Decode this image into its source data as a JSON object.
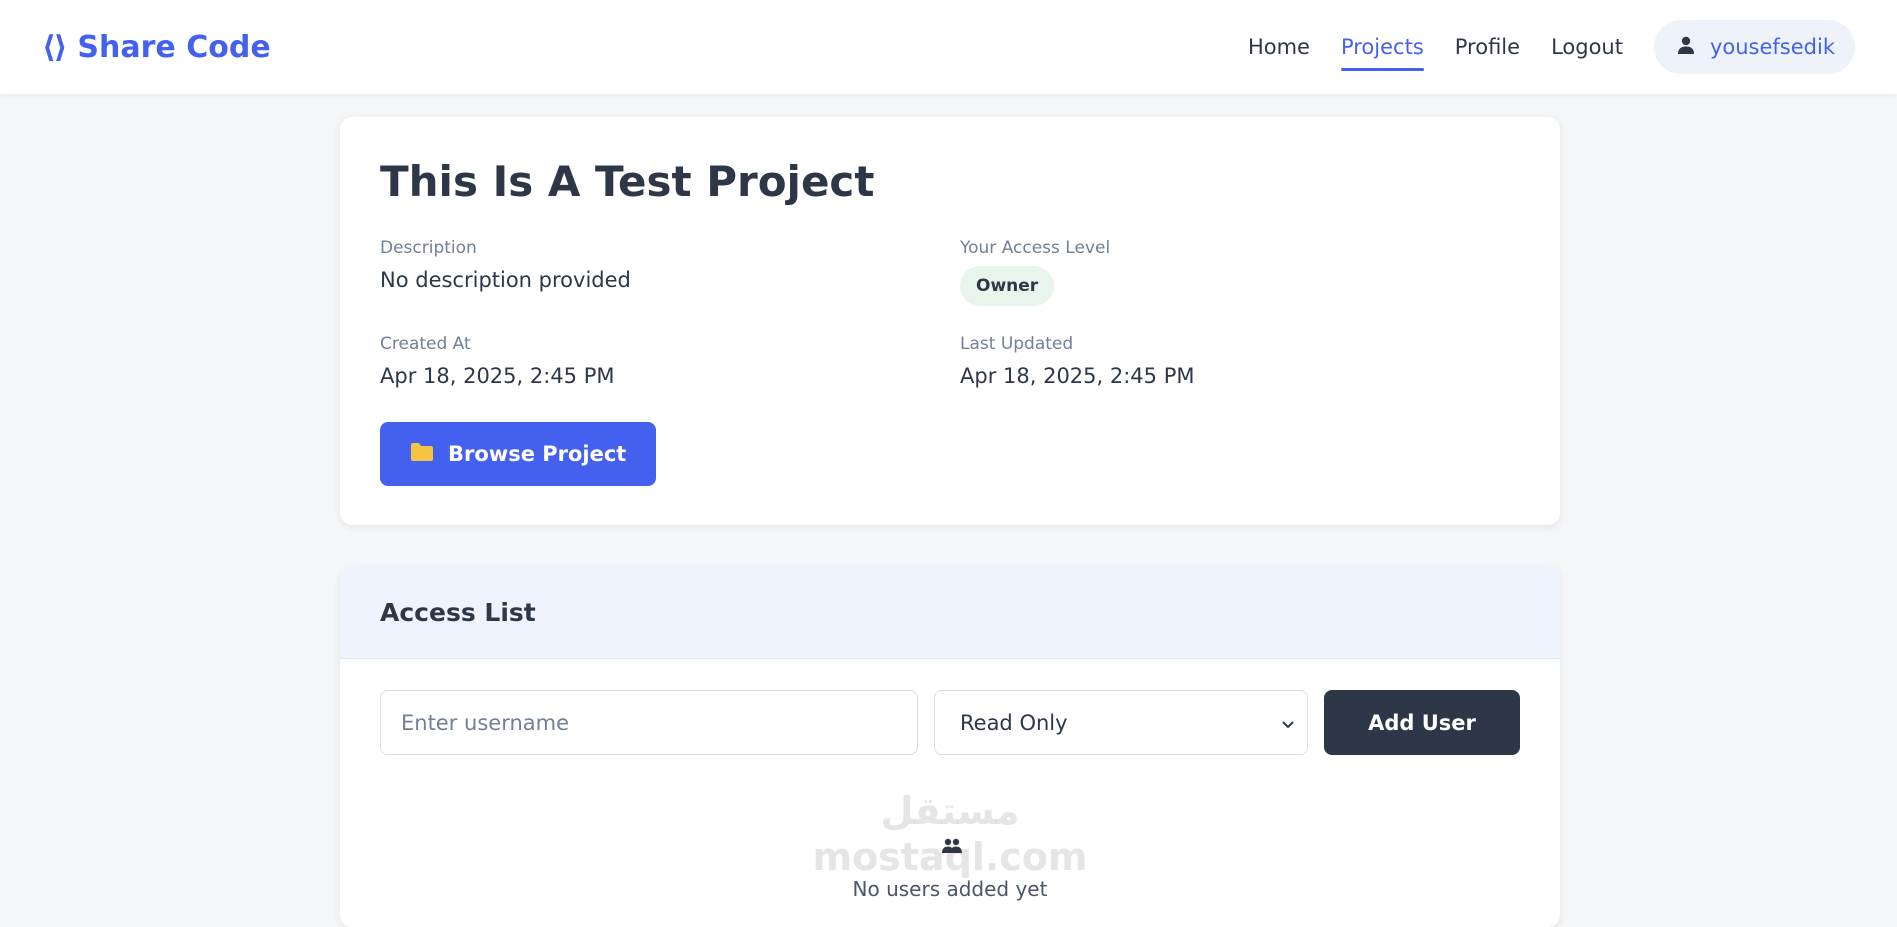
{
  "navbar": {
    "brand_text": "Share Code",
    "brand_icon": "code-icon",
    "links": [
      {
        "label": "Home"
      },
      {
        "label": "Projects"
      },
      {
        "label": "Profile"
      },
      {
        "label": "Logout"
      }
    ],
    "active_link": "Projects",
    "username": "yousefsedik",
    "user_icon": "user-icon"
  },
  "project": {
    "title": "This Is A Test Project",
    "description_label": "Description",
    "description_value": "No description provided",
    "access_label": "Your Access Level",
    "access_value": "Owner",
    "created_label": "Created At",
    "created_value": "Apr 18, 2025, 2:45 PM",
    "updated_label": "Last Updated",
    "updated_value": "Apr 18, 2025, 2:45 PM",
    "browse_label": "Browse Project",
    "browse_icon": "folder-icon"
  },
  "access": {
    "title": "Access List",
    "username_placeholder": "Enter username",
    "role_selected": "Read Only",
    "add_label": "Add User",
    "empty_icon": "users-icon",
    "empty_text": "No users added yet"
  },
  "watermark": {
    "arabic": "مستقل",
    "latin": "mostaql.com"
  },
  "colors": {
    "accent": "#4361ee",
    "dark_button": "#2d3748",
    "badge_bg": "#e7f5ec",
    "folder": "#f6c343"
  }
}
